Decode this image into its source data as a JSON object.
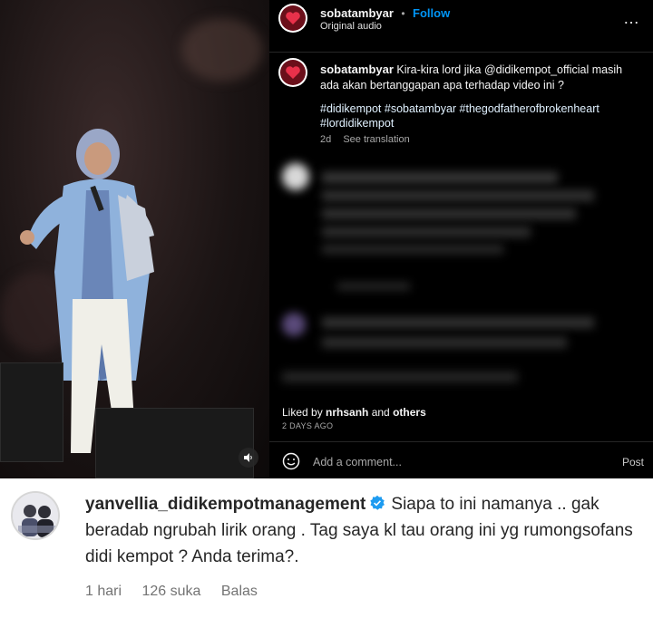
{
  "post": {
    "username": "sobatambyar",
    "follow_label": "Follow",
    "audio": "Original audio",
    "more_icon": "…",
    "caption": "Kira-kira lord jika @didikempot_official masih ada akan bertanggapan apa terhadap video ini ?",
    "hashtags": "#didikempot #sobatambyar #thegodfatherofbrokenheart #lordidikempot",
    "age": "2d",
    "see_translation": "See translation",
    "liked_by_prefix": "Liked by ",
    "liked_by_user": "nrhsanh",
    "liked_by_suffix": " and ",
    "liked_by_others": "others",
    "date": "2 DAYS AGO",
    "add_comment_placeholder": "Add a comment...",
    "post_label": "Post",
    "accent_color": "#0095f6"
  },
  "comment": {
    "username": "yanvellia_didikempotmanagement",
    "text": "Siapa to ini namanya .. gak beradab ngrubah lirik orang . Tag saya kl tau orang ini yg rumongsofans didi kempot ? Anda terima?.",
    "time": "1 hari",
    "likes": "126 suka",
    "reply_label": "Balas"
  }
}
